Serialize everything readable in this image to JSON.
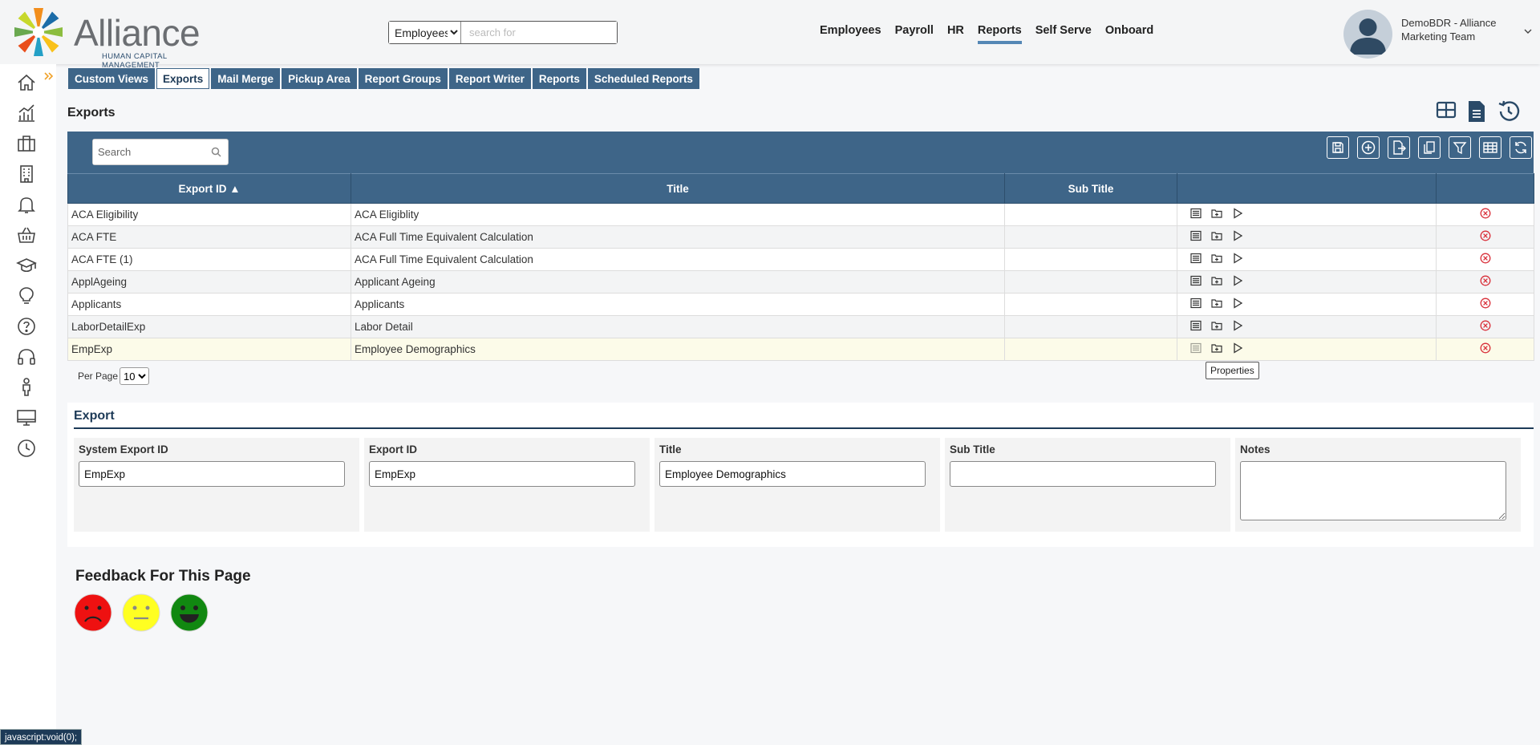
{
  "logo": {
    "name": "Alliance",
    "tagline": "HUMAN CAPITAL MANAGEMENT"
  },
  "search": {
    "scope": "Employees",
    "scope_options": [
      "Employees"
    ],
    "placeholder": "search for"
  },
  "topnav": [
    {
      "label": "Employees",
      "active": false
    },
    {
      "label": "Payroll",
      "active": false
    },
    {
      "label": "HR",
      "active": false
    },
    {
      "label": "Reports",
      "active": true
    },
    {
      "label": "Self Serve",
      "active": false
    },
    {
      "label": "Onboard",
      "active": false
    }
  ],
  "user": {
    "line1": "DemoBDR - Alliance",
    "line2": "Marketing Team"
  },
  "sidebar": {
    "icons": [
      "home-icon",
      "analytics-icon",
      "briefcase-icon",
      "building-icon",
      "bell-icon",
      "basket-icon",
      "graduation-cap-icon",
      "lightbulb-icon",
      "help-icon",
      "headset-icon",
      "person-icon",
      "monitor-icon",
      "clock-icon"
    ],
    "expand_icon": "double-chevron-right-icon"
  },
  "tabs": [
    {
      "label": "Custom Views",
      "active": false
    },
    {
      "label": "Exports",
      "active": true
    },
    {
      "label": "Mail Merge",
      "active": false
    },
    {
      "label": "Pickup Area",
      "active": false
    },
    {
      "label": "Report Groups",
      "active": false
    },
    {
      "label": "Report Writer",
      "active": false
    },
    {
      "label": "Reports",
      "active": false
    },
    {
      "label": "Scheduled Reports",
      "active": false
    }
  ],
  "page_title": "Exports",
  "grid": {
    "search_placeholder": "Search",
    "columns": [
      "Export ID ▲",
      "Title",
      "Sub Title",
      "",
      ""
    ],
    "rows": [
      {
        "id": "ACA Eligibility",
        "title": "ACA Eligiblity",
        "subtitle": ""
      },
      {
        "id": "ACA FTE",
        "title": "ACA Full Time Equivalent Calculation",
        "subtitle": ""
      },
      {
        "id": "ACA FTE (1)",
        "title": "ACA Full Time Equivalent Calculation",
        "subtitle": ""
      },
      {
        "id": "ApplAgeing",
        "title": "Applicant Ageing",
        "subtitle": ""
      },
      {
        "id": "Applicants",
        "title": "Applicants",
        "subtitle": ""
      },
      {
        "id": "LaborDetailExp",
        "title": "Labor Detail",
        "subtitle": ""
      },
      {
        "id": "EmpExp",
        "title": "Employee Demographics",
        "subtitle": ""
      }
    ],
    "selected_row": 6,
    "per_page_label": "Per Page",
    "per_page": "10",
    "tooltip": "Properties"
  },
  "export_form": {
    "title": "Export",
    "fields": [
      {
        "label": "System Export ID",
        "value": "EmpExp"
      },
      {
        "label": "Export ID",
        "value": "EmpExp"
      },
      {
        "label": "Title",
        "value": "Employee Demographics"
      },
      {
        "label": "Sub Title",
        "value": ""
      },
      {
        "label": "Notes",
        "value": ""
      }
    ]
  },
  "feedback": {
    "title": "Feedback For This Page"
  },
  "status_bar": "javascript:void(0);",
  "colors": {
    "primary": "#3e6588",
    "accent": "#5487b5",
    "dark": "#1d3a57",
    "sad": "#ee1111",
    "neutral": "#ffff22",
    "happy": "#118811"
  }
}
